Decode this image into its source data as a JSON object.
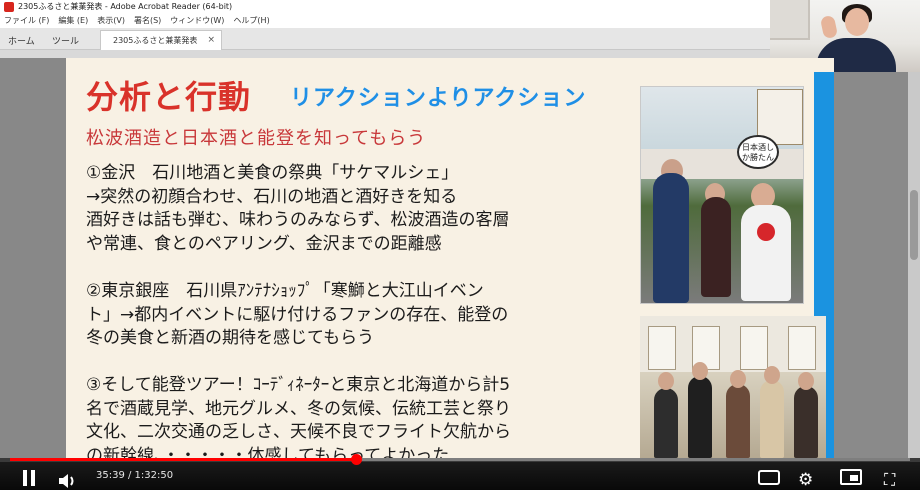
{
  "window": {
    "title": "2305ふるさと兼業発表 - Adobe Acrobat Reader (64-bit)",
    "menu": [
      "ファイル (F)",
      "編集 (E)",
      "表示(V)",
      "署名(S)",
      "ウィンドウ(W)",
      "ヘルプ(H)"
    ],
    "tabs": {
      "home": "ホーム",
      "tools": "ツール",
      "document": "2305ふるさと兼業発表"
    },
    "close_glyph": "×"
  },
  "slide": {
    "title": "分析と行動",
    "subtitle": "リアクションよりアクション",
    "heading": "松波酒造と日本酒と能登を知ってもらう",
    "paragraphs": [
      "①金沢　石川地酒と美食の祭典「サケマルシェ」\n→突然の初顔合わせ、石川の地酒と酒好きを知る\n酒好きは話も弾む、味わうのみならず、松波酒造の客層\nや常連、食とのペアリング、金沢までの距離感",
      "②東京銀座　石川県ｱﾝﾃﾅｼｮｯﾌﾟ「寒鰤と大江山イベン\nト」→都内イベントに駆け付けるファンの存在、能登の\n冬の美食と新酒の期待を感じてもらう",
      "③そして能登ツアー！ｺｰﾃﾞｨﾈｰﾀｰと東京と北海道から計5\n名で酒蔵見学、地元グルメ、冬の気候、伝統工芸と祭り\n文化、二次交通の乏しさ、天候不良でフライト欠航から\nの新幹線、・・・・・体感してもらってよかった"
    ],
    "photo_bubble": "日本酒しか勝たん"
  },
  "player": {
    "current_time": "35:39",
    "duration": "1:32:50",
    "time_display": "35:39 / 1:32:50",
    "progress": 0.384,
    "gear_glyph": "⚙",
    "fullscreen_glyph": "⛶"
  },
  "colors": {
    "title_red": "#d9322a",
    "subtitle_blue": "#1f8fe6",
    "slide_bg": "#f8f1e4",
    "accent_blue_bar": "#1b93e0",
    "progress_red": "#ff0000"
  }
}
